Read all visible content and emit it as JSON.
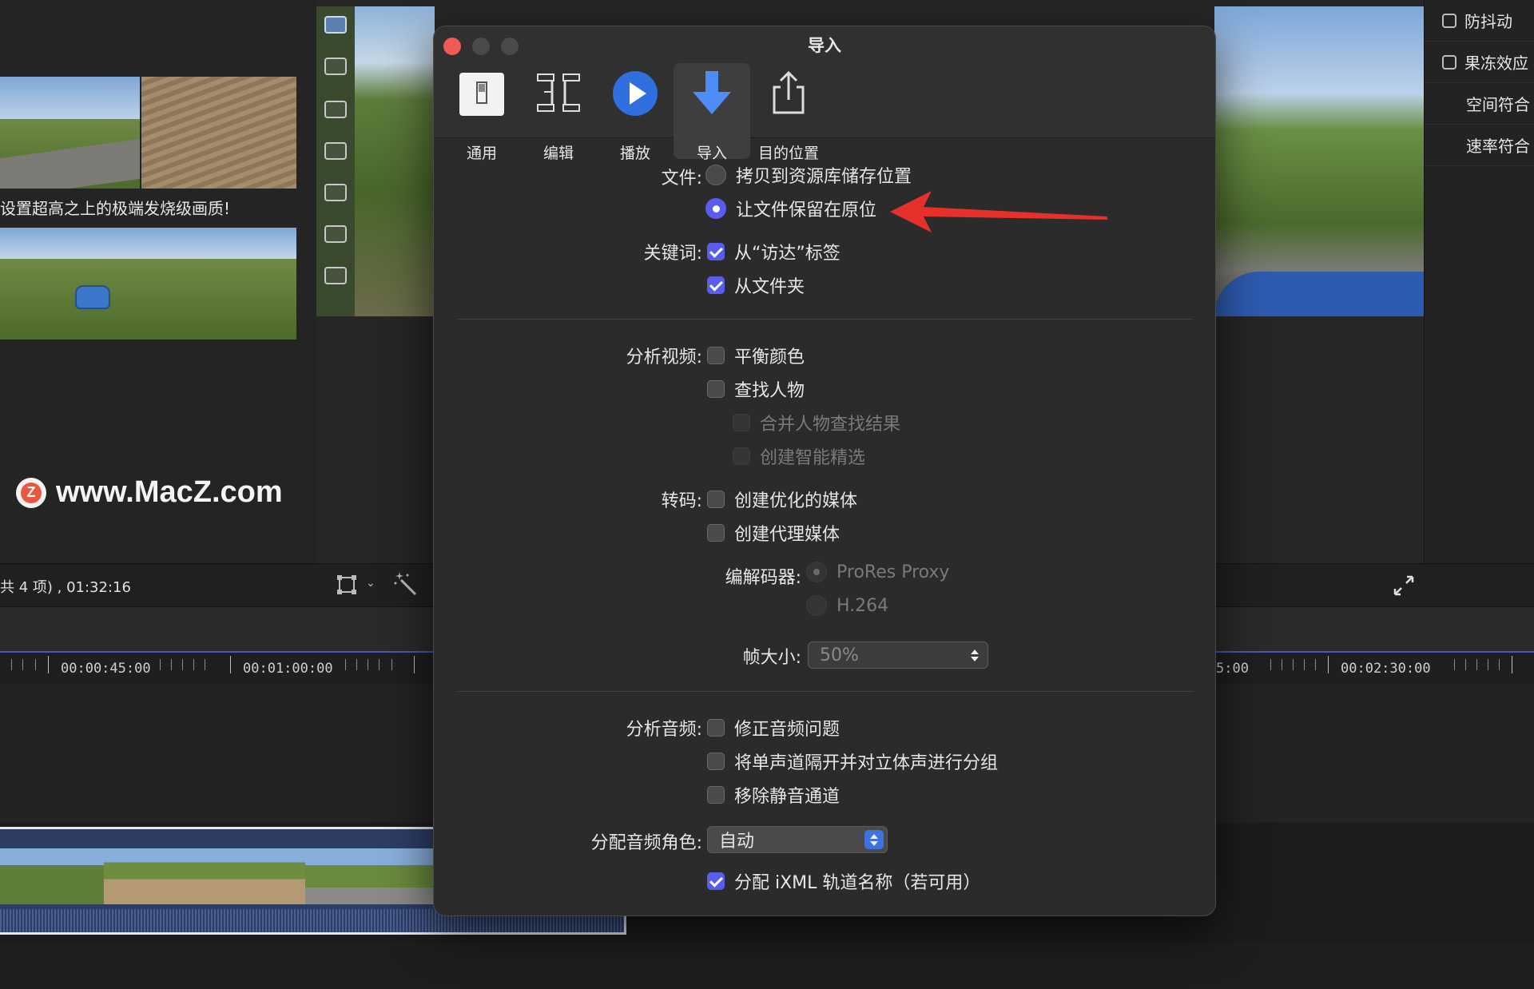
{
  "browser": {
    "caption": "设置超高之上的极端发烧级画质!",
    "watermark": "www.MacZ.com",
    "watermark_logo": "Z"
  },
  "inspector": {
    "items": [
      {
        "label": "防抖动",
        "checkbox": true
      },
      {
        "label": "果冻效应",
        "checkbox": true
      },
      {
        "label": "空间符合",
        "checkbox": false
      },
      {
        "label": "速率符合",
        "checkbox": false
      }
    ]
  },
  "status": {
    "text": "共 4 项) , 01:32:16"
  },
  "timeline": {
    "timecodes_left": [
      "00:00:45:00",
      "00:01:00:00"
    ],
    "timecodes_right": [
      "5:00",
      "00:02:30:00"
    ]
  },
  "dialog": {
    "title": "导入",
    "tabs": [
      {
        "label": "通用",
        "icon": "switch-icon"
      },
      {
        "label": "编辑",
        "icon": "film-edit-icon"
      },
      {
        "label": "播放",
        "icon": "play-icon"
      },
      {
        "label": "导入",
        "icon": "download-arrow-icon",
        "selected": true
      },
      {
        "label": "目的位置",
        "icon": "share-icon"
      }
    ],
    "files_label": "文件:",
    "files_opt1": "拷贝到资源库储存位置",
    "files_opt2": "让文件保留在原位",
    "files_selected": "让文件保留在原位",
    "keywords_label": "关键词:",
    "kw_opt1": "从“访达”标签",
    "kw_opt2": "从文件夹",
    "analyze_video_label": "分析视频:",
    "av_opt1": "平衡颜色",
    "av_opt2": "查找人物",
    "av_opt3": "合并人物查找结果",
    "av_opt4": "创建智能精选",
    "transcode_label": "转码:",
    "tc_opt1": "创建优化的媒体",
    "tc_opt2": "创建代理媒体",
    "codec_label": "编解码器:",
    "codec_opt1": "ProRes Proxy",
    "codec_opt2": "H.264",
    "frame_label": "帧大小:",
    "frame_value": "50%",
    "analyze_audio_label": "分析音频:",
    "aa_opt1": "修正音频问题",
    "aa_opt2": "将单声道隔开并对立体声进行分组",
    "aa_opt3": "移除静音通道",
    "role_label": "分配音频角色:",
    "role_value": "自动",
    "ixml_label": "分配 iXML 轨道名称（若可用）",
    "accent_color": "#5a5cf0",
    "annotation_arrow_color": "#e8302a"
  }
}
